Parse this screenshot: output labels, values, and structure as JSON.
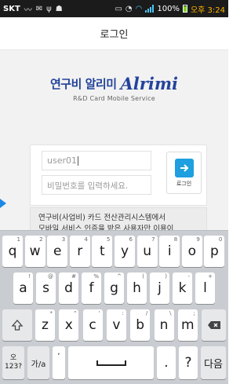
{
  "status_bar": {
    "carrier": "SKT",
    "icons": [
      "signal-mode-icon",
      "message-icon",
      "usb-icon",
      "android-icon",
      "screen-mirror-icon",
      "alarm-icon",
      "wifi-icon",
      "cell-signal-icon"
    ],
    "battery": "100%",
    "time": "오후 3:24",
    "battery_level": 1.0
  },
  "header": {
    "title": "로그인"
  },
  "brand": {
    "korean": "연구비 알리미",
    "english": "Alrimi",
    "subtitle": "R&D Card Mobile Service",
    "color": "#23439b"
  },
  "login_form": {
    "id_value": "user01",
    "password_placeholder": "비밀번호를 입력하세요.",
    "login_button_label": "로그인",
    "button_color": "#1e9fe0"
  },
  "notice": {
    "line1": "연구비(사업비) 카드 전산관리시스템에서",
    "line2": "모바일 서비스 인증을 받은 사용자만 이용이"
  },
  "keyboard": {
    "row1": [
      {
        "label": "q",
        "hint": "1"
      },
      {
        "label": "w",
        "hint": "2"
      },
      {
        "label": "e",
        "hint": "3"
      },
      {
        "label": "r",
        "hint": "4"
      },
      {
        "label": "t",
        "hint": "5"
      },
      {
        "label": "y",
        "hint": "6"
      },
      {
        "label": "u",
        "hint": "7"
      },
      {
        "label": "i",
        "hint": "8"
      },
      {
        "label": "o",
        "hint": "9"
      },
      {
        "label": "p",
        "hint": "0"
      }
    ],
    "row2": [
      {
        "label": "a",
        "hint": "!"
      },
      {
        "label": "s",
        "hint": "@"
      },
      {
        "label": "d",
        "hint": "#"
      },
      {
        "label": "f",
        "hint": "%"
      },
      {
        "label": "g",
        "hint": "^"
      },
      {
        "label": "h",
        "hint": "("
      },
      {
        "label": "j",
        "hint": ")"
      },
      {
        "label": "k",
        "hint": "-"
      },
      {
        "label": "l",
        "hint": "+"
      }
    ],
    "row3": [
      {
        "label": "z",
        "hint": "*"
      },
      {
        "label": "x",
        "hint": "\""
      },
      {
        "label": "c",
        "hint": "'"
      },
      {
        "label": "v",
        "hint": ":"
      },
      {
        "label": "b",
        "hint": "/"
      },
      {
        "label": "n",
        "hint": "\\"
      },
      {
        "label": "m",
        "hint": ";"
      }
    ],
    "shift_icon": "shift-icon",
    "backspace_icon": "backspace-icon",
    "symbols_label_top": "오",
    "symbols_label_bottom": "123?",
    "lang_label": "가/a",
    "comma_label": ",",
    "period_label": ".",
    "question_label": "?",
    "next_label": "다음"
  }
}
